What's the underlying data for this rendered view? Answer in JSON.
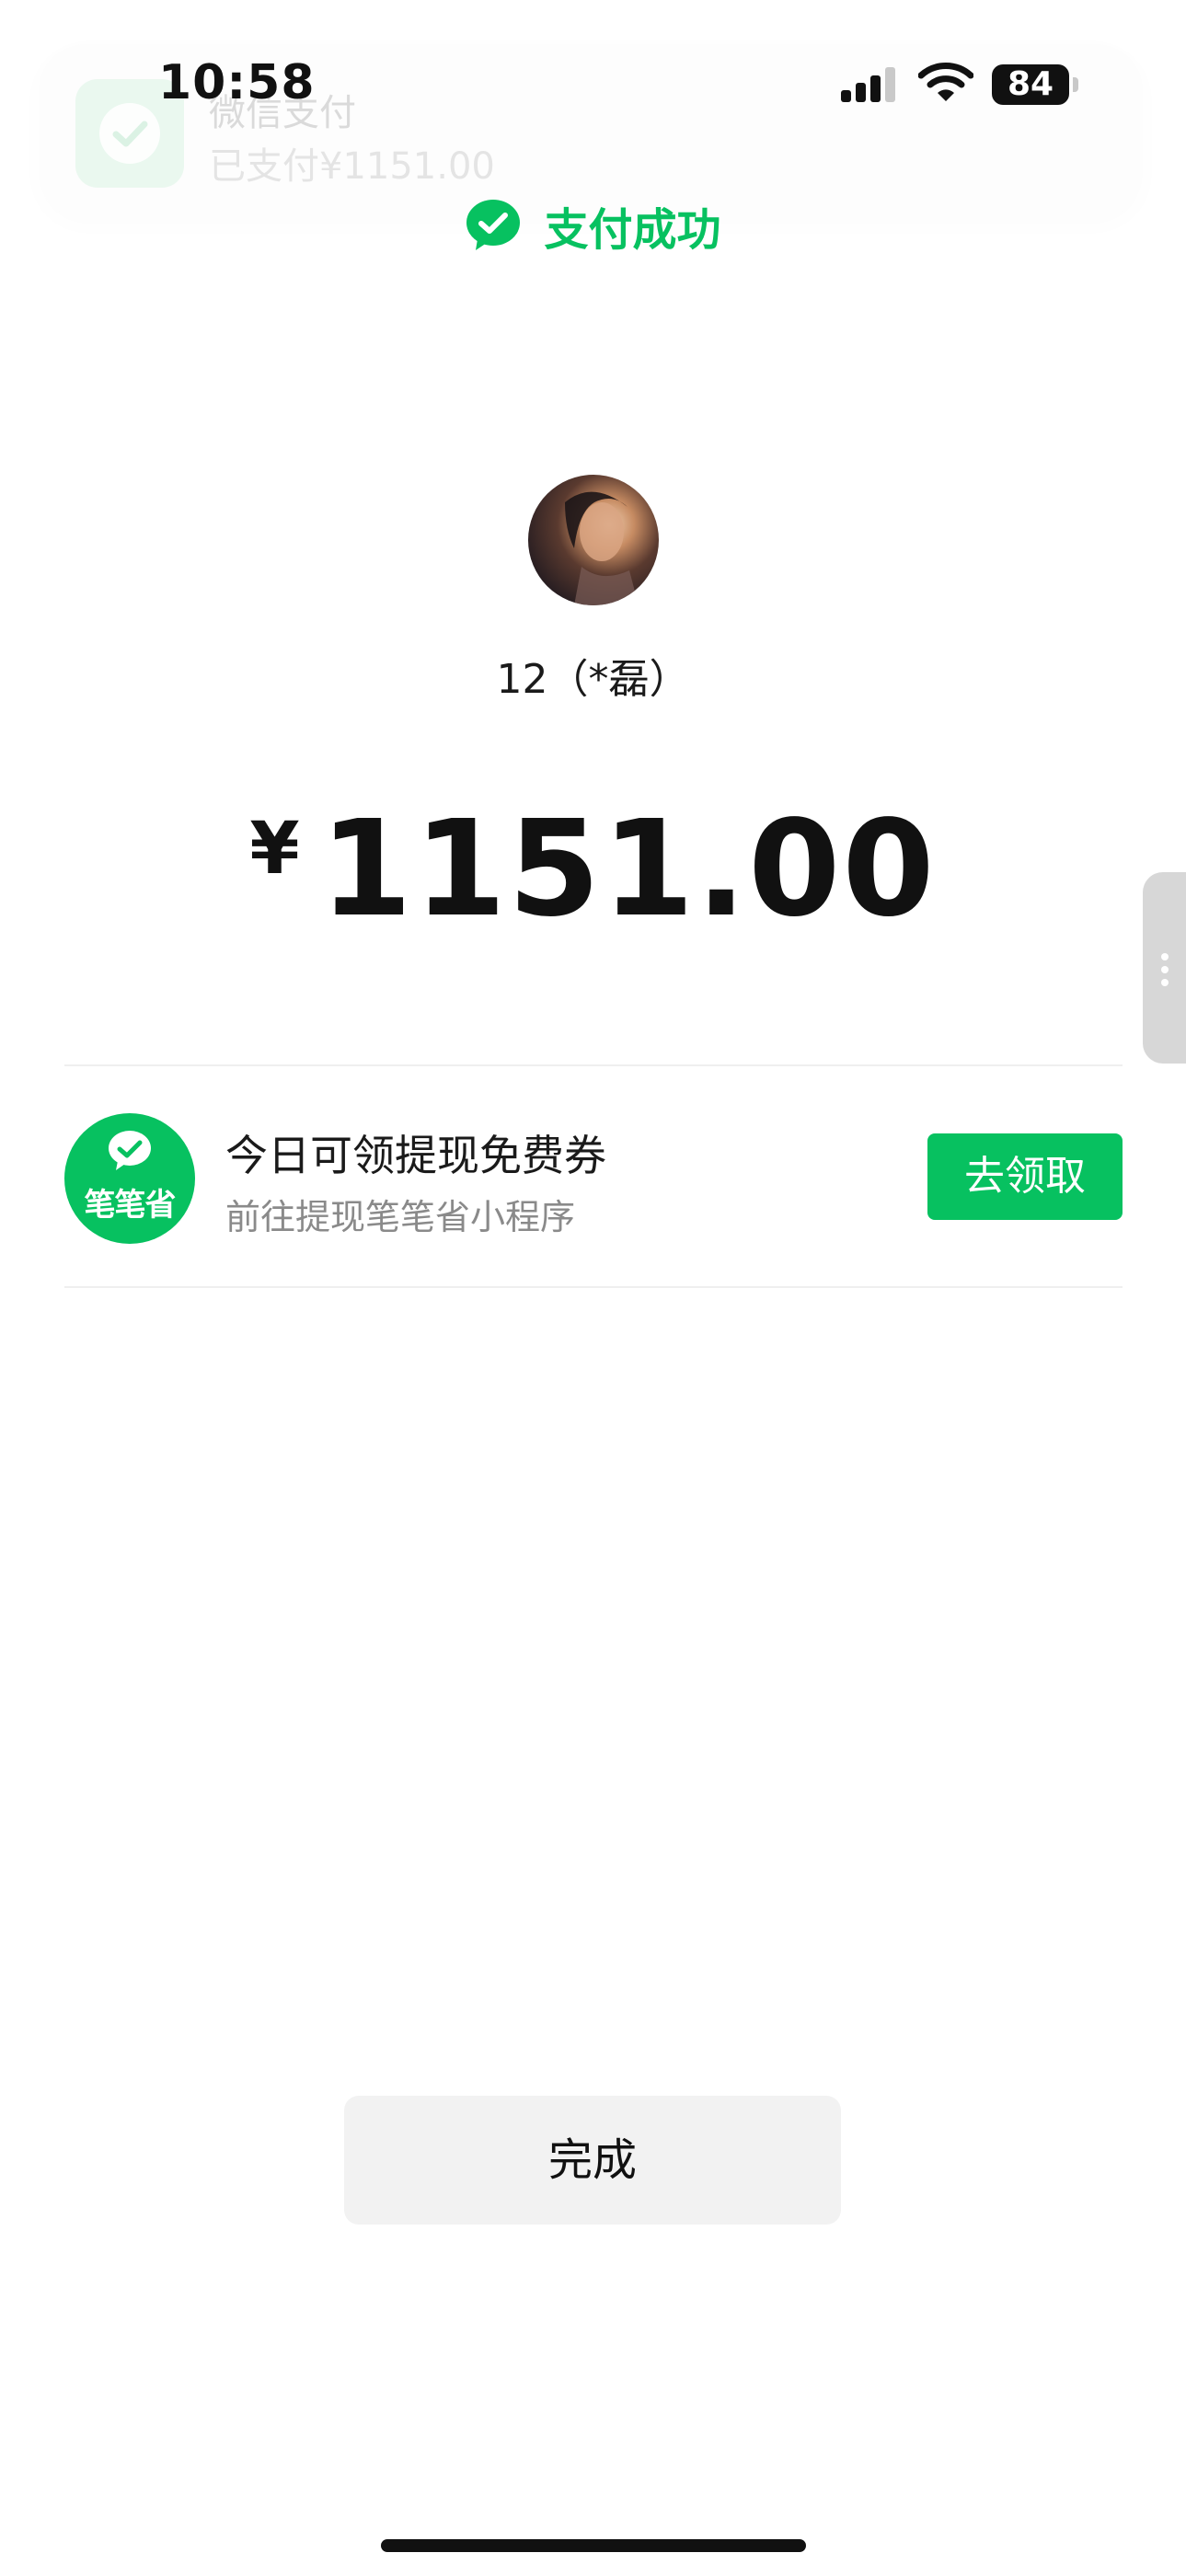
{
  "status_bar": {
    "time": "10:58",
    "battery": "84"
  },
  "notification": {
    "title": "微信支付",
    "subtitle": "已支付¥1151.00"
  },
  "header": {
    "status_text": "支付成功",
    "accent_color": "#07c160"
  },
  "payee": {
    "name": "12（*磊）"
  },
  "payment": {
    "currency_symbol": "¥",
    "amount": "1151.00"
  },
  "promo": {
    "logo_text": "笔笔省",
    "title": "今日可领提现免费券",
    "subtitle": "前往提现笔笔省小程序",
    "button_label": "去领取"
  },
  "footer": {
    "done_label": "完成"
  }
}
